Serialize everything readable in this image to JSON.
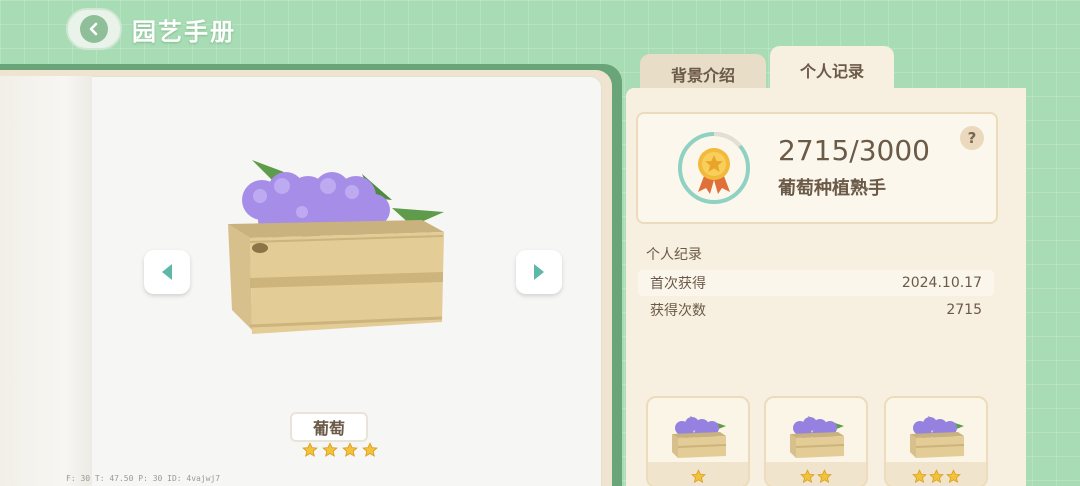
{
  "header": {
    "title": "园艺手册"
  },
  "tabs": [
    {
      "label": "背景介绍",
      "active": false
    },
    {
      "label": "个人记录",
      "active": true
    }
  ],
  "item": {
    "name": "葡萄",
    "stars": 4
  },
  "stats": {
    "progress": "2715/3000",
    "title": "葡萄种植熟手"
  },
  "records": {
    "header": "个人纪录",
    "rows": [
      {
        "label": "首次获得",
        "value": "2024.10.17"
      },
      {
        "label": "获得次数",
        "value": "2715"
      }
    ]
  },
  "tiers": [
    {
      "stars": 1
    },
    {
      "stars": 2
    },
    {
      "stars": 3
    }
  ],
  "debug": "F: 30   T: 47.50   P: 30   ID: 4vajwj7",
  "colors": {
    "background": "#a8dcb4",
    "star": "#f2c23a",
    "text_brown": "#6b5a48",
    "arrow_teal": "#5fb8a6"
  }
}
